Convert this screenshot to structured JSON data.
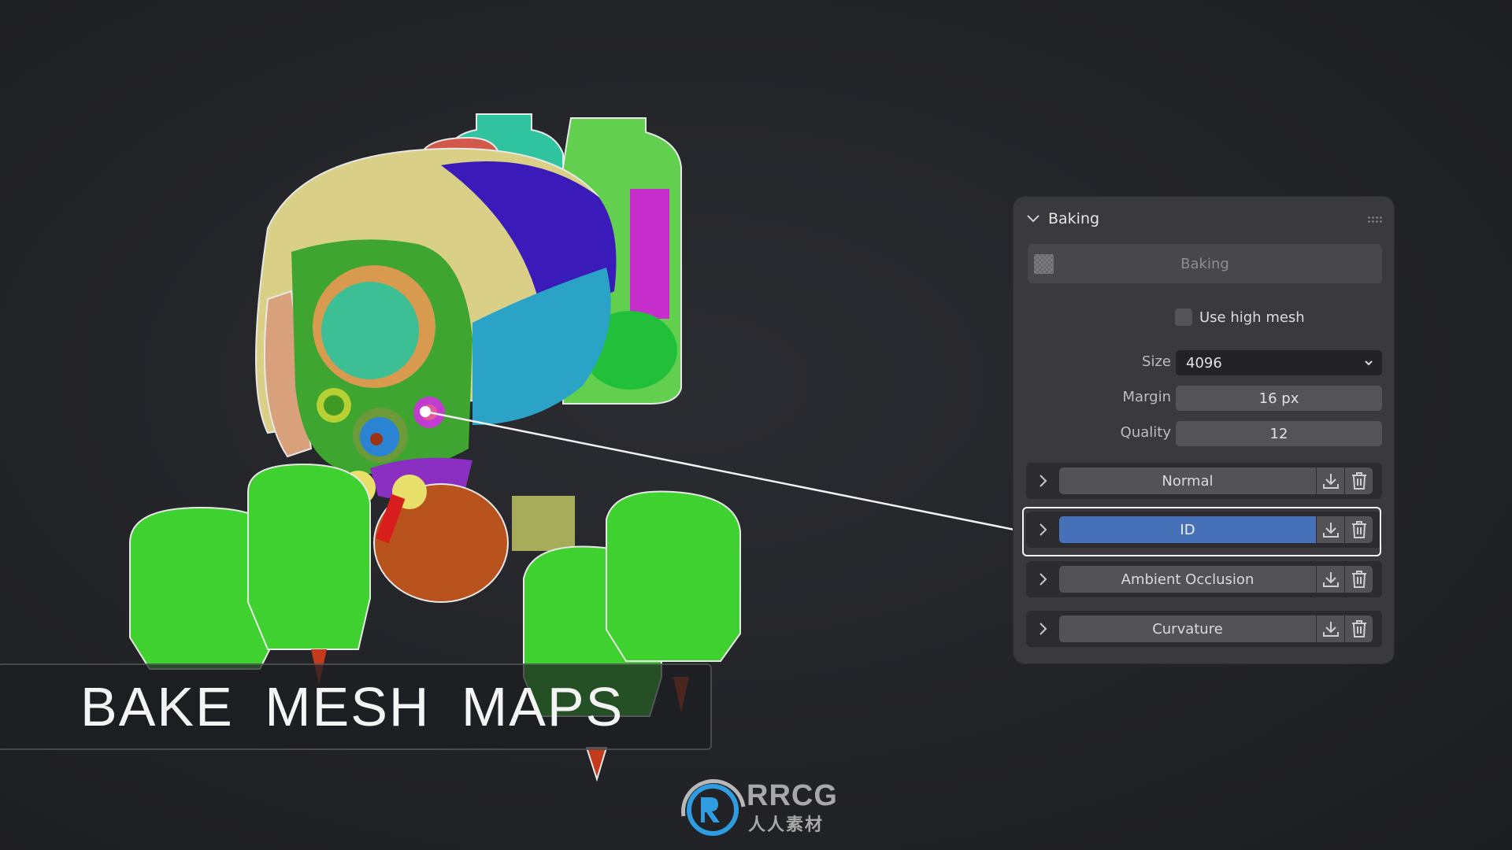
{
  "overlay": {
    "title": "BAKE MESH MAPS"
  },
  "panel": {
    "title": "Baking",
    "collapse_icon": "chevron-down-icon",
    "grip_icon": "drag-grip-icon",
    "bake_button": {
      "label": "Baking",
      "icon": "checker-texture-icon",
      "state": "disabled"
    },
    "use_high_mesh": {
      "label": "Use high mesh",
      "checked": false
    },
    "fields": {
      "size": {
        "label": "Size",
        "value": "4096"
      },
      "margin": {
        "label": "Margin",
        "value": "16 px"
      },
      "quality": {
        "label": "Quality",
        "value": "12"
      }
    },
    "maps": [
      {
        "name": "Normal",
        "active": false
      },
      {
        "name": "ID",
        "active": true
      },
      {
        "name": "Ambient Occlusion",
        "active": false
      },
      {
        "name": "Curvature",
        "active": false
      }
    ],
    "map_actions": {
      "download_icon": "download-icon",
      "delete_icon": "trash-icon",
      "expand_icon": "chevron-right-icon"
    }
  },
  "colors": {
    "panel_bg": "#3a393d",
    "active_map": "#4670b8",
    "highlight": "#f5f5f5"
  },
  "watermark": {
    "brand": "RRCG",
    "subtitle": "人人素材"
  }
}
